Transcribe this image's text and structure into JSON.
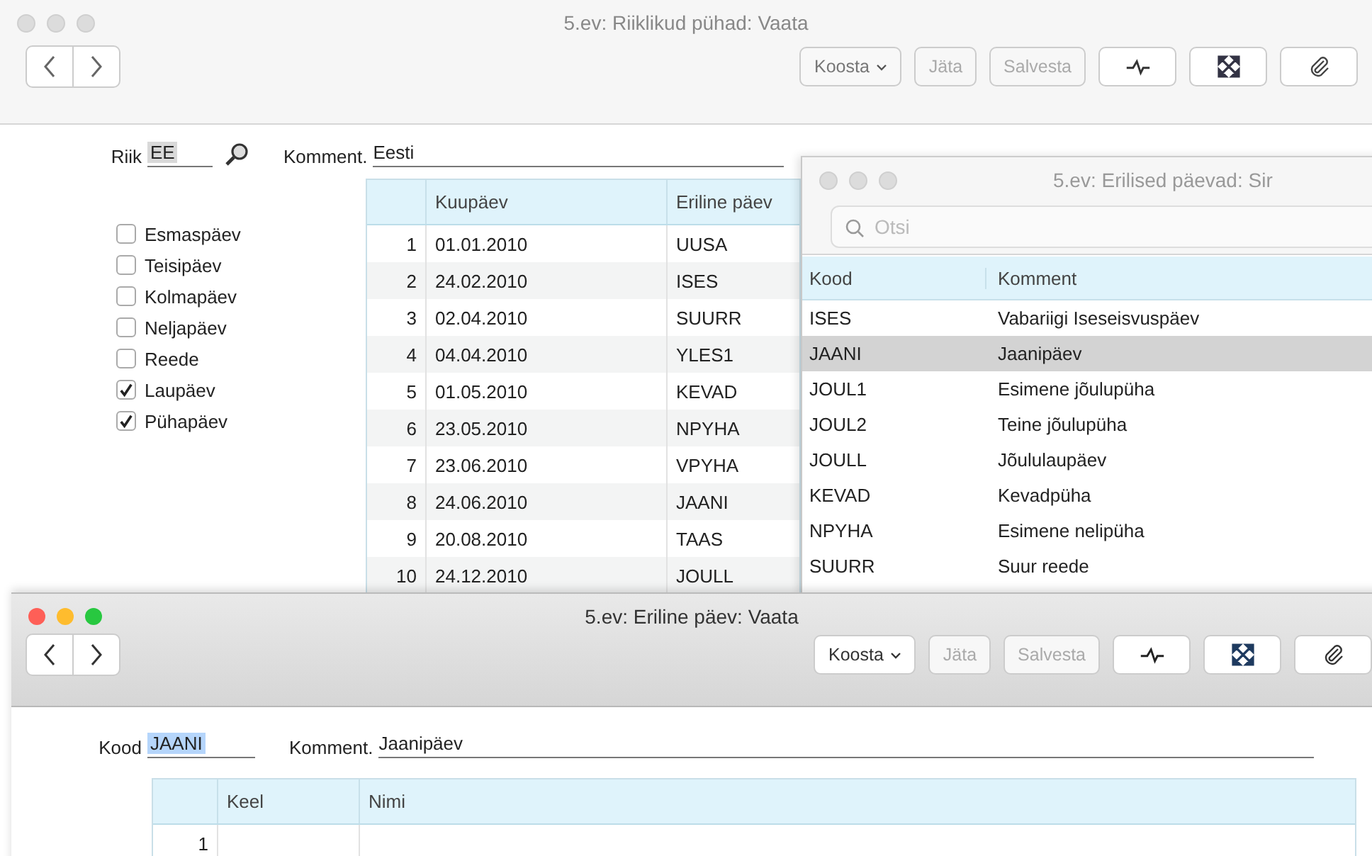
{
  "main_window": {
    "title": "5.ev: Riiklikud pühad: Vaata",
    "active": false,
    "toolbar": [
      {
        "kind": "menu",
        "label": "Koosta",
        "disabled": false
      },
      {
        "kind": "text",
        "label": "Jäta",
        "disabled": true
      },
      {
        "kind": "text",
        "label": "Salvesta",
        "disabled": true
      }
    ],
    "country": {
      "label": "Riik",
      "value": "EE"
    },
    "comment": {
      "label": "Komment.",
      "value": "Eesti"
    },
    "weekdays": [
      {
        "label": "Esmaspäev",
        "checked": false
      },
      {
        "label": "Teisipäev",
        "checked": false
      },
      {
        "label": "Kolmapäev",
        "checked": false
      },
      {
        "label": "Neljapäev",
        "checked": false
      },
      {
        "label": "Reede",
        "checked": false
      },
      {
        "label": "Laupäev",
        "checked": true
      },
      {
        "label": "Pühapäev",
        "checked": true
      }
    ],
    "table": {
      "columns": [
        "Kuupäev",
        "Eriline päev"
      ],
      "rows": [
        {
          "n": "1",
          "date": "01.01.2010",
          "code": "UUSA"
        },
        {
          "n": "2",
          "date": "24.02.2010",
          "code": "ISES"
        },
        {
          "n": "3",
          "date": "02.04.2010",
          "code": "SUURR"
        },
        {
          "n": "4",
          "date": "04.04.2010",
          "code": "YLES1"
        },
        {
          "n": "5",
          "date": "01.05.2010",
          "code": "KEVAD"
        },
        {
          "n": "6",
          "date": "23.05.2010",
          "code": "NPYHA"
        },
        {
          "n": "7",
          "date": "23.06.2010",
          "code": "VPYHA"
        },
        {
          "n": "8",
          "date": "24.06.2010",
          "code": "JAANI"
        },
        {
          "n": "9",
          "date": "20.08.2010",
          "code": "TAAS"
        },
        {
          "n": "10",
          "date": "24.12.2010",
          "code": "JOULL"
        }
      ]
    }
  },
  "lookup_window": {
    "title": "5.ev: Erilised päevad: Sir",
    "active": false,
    "search": {
      "placeholder": "Otsi"
    },
    "columns": [
      "Kood",
      "Komment"
    ],
    "rows": [
      {
        "code": "ISES",
        "comment": "Vabariigi Iseseisvuspäev",
        "selected": false
      },
      {
        "code": "JAANI",
        "comment": "Jaanipäev",
        "selected": true
      },
      {
        "code": "JOUL1",
        "comment": "Esimene jõulupüha",
        "selected": false
      },
      {
        "code": "JOUL2",
        "comment": "Teine jõulupüha",
        "selected": false
      },
      {
        "code": "JOULL",
        "comment": "Jõululaupäev",
        "selected": false
      },
      {
        "code": "KEVAD",
        "comment": "Kevadpüha",
        "selected": false
      },
      {
        "code": "NPYHA",
        "comment": "Esimene nelipüha",
        "selected": false
      },
      {
        "code": "SUURR",
        "comment": "Suur reede",
        "selected": false
      }
    ]
  },
  "detail_window": {
    "title": "5.ev: Eriline päev: Vaata",
    "active": true,
    "toolbar": [
      {
        "kind": "menu",
        "label": "Koosta",
        "disabled": false
      },
      {
        "kind": "text",
        "label": "Jäta",
        "disabled": true
      },
      {
        "kind": "text",
        "label": "Salvesta",
        "disabled": true
      }
    ],
    "code": {
      "label": "Kood",
      "value": "JAANI",
      "selected": true
    },
    "comment": {
      "label": "Komment.",
      "value": "Jaanipäev"
    },
    "table": {
      "columns": [
        "Keel",
        "Nimi"
      ],
      "rows": [
        {
          "n": "1"
        }
      ]
    }
  }
}
